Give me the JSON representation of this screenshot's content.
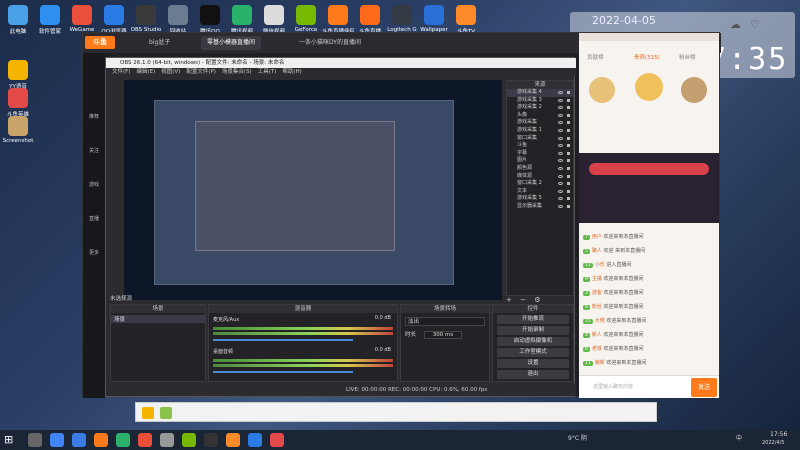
{
  "desktop_icons_top": [
    {
      "label": "此电脑",
      "color": "#4aa0e6"
    },
    {
      "label": "软件管家",
      "color": "#2f8ff0"
    },
    {
      "label": "WeGame",
      "color": "#e94f3a"
    },
    {
      "label": "QQ浏览器",
      "color": "#2b7be4"
    },
    {
      "label": "OBS Studio",
      "color": "#3a3a3a"
    },
    {
      "label": "回收站",
      "color": "#6b7c90"
    },
    {
      "label": "腾讯QQ",
      "color": "#111111"
    },
    {
      "label": "腾讯视频",
      "color": "#2ab26a"
    },
    {
      "label": "微信视频",
      "color": "#dcdcdc"
    },
    {
      "label": "GeForce",
      "color": "#76b900"
    },
    {
      "label": "斗鱼直播伴侣",
      "color": "#ff7a1a"
    },
    {
      "label": "斗鱼直播",
      "color": "#ff6a1a"
    },
    {
      "label": "Logitech G",
      "color": "#333a44"
    },
    {
      "label": "Wallpaper",
      "color": "#2a6fd6"
    },
    {
      "label": "斗鱼TV",
      "color": "#ff8a2a"
    }
  ],
  "desktop_icons_left": [
    {
      "label": "YY语音",
      "color": "#f4b400"
    },
    {
      "label": "斗鱼英雄",
      "color": "#e24a4a"
    },
    {
      "label": "Screenshot",
      "color": "#c9a46a"
    }
  ],
  "clock_widget": {
    "date": "2022-04-05",
    "time": "17:35",
    "weather_icons": [
      "☁",
      "♡"
    ]
  },
  "douyu": {
    "logo": "斗鱼",
    "tabs": [
      "big盆子",
      "零基小模器直播间",
      "一条小猫咪DY的直播间"
    ],
    "sidebar": [
      "推荐",
      "关注",
      "游戏",
      "直播",
      "更多"
    ],
    "chat_tabs": [
      "贡献榜",
      "贵宾(315)",
      "粉丝榜"
    ],
    "chat_messages": [
      {
        "level": "7",
        "name": "用户",
        "text": "欢迎来到本直播间"
      },
      {
        "level": "5",
        "name": "路人",
        "text": "欢迎 来到本直播间"
      },
      {
        "level": "12",
        "name": "小乐",
        "text": "进入直播间"
      },
      {
        "level": "9",
        "name": "主播",
        "text": "欢迎来到本直播间"
      },
      {
        "level": "3",
        "name": "游客",
        "text": "欢迎来到本直播间"
      },
      {
        "level": "8",
        "name": "粉丝",
        "text": "欢迎来到本直播间"
      },
      {
        "level": "15",
        "name": "大佬",
        "text": "欢迎来到本直播间"
      },
      {
        "level": "4",
        "name": "新人",
        "text": "欢迎来到本直播间"
      },
      {
        "level": "6",
        "name": "老铁",
        "text": "欢迎来到本直播间"
      },
      {
        "level": "11",
        "name": "萌新",
        "text": "欢迎来到本直播间"
      }
    ],
    "send_button": "发送",
    "input_placeholder": "这里输入聊天内容"
  },
  "obs": {
    "title": "OBS 26.1.0 (64-bit, windows) - 配置文件: 未命名 - 场景: 未命名",
    "menus": [
      "文件(F)",
      "编辑(E)",
      "视图(V)",
      "配置文件(P)",
      "场景集合(S)",
      "工具(T)",
      "帮助(H)"
    ],
    "sources_header": "来源",
    "sources": [
      "游戏采集 4",
      "游戏采集 3",
      "游戏采集 2",
      "头像",
      "游戏采集",
      "游戏采集 1",
      "窗口采集",
      "斗鱼",
      "字幕",
      "图片",
      "颜色源",
      "媒体源",
      "窗口采集 2",
      "文本",
      "游戏采集 5",
      "显示器采集"
    ],
    "scenes_header": "场景",
    "scene_item": "场景",
    "mixer_header": "混音器",
    "mixer": [
      {
        "name": "麦克风/Aux",
        "db": "0.0 dB"
      },
      {
        "name": "桌面音频",
        "db": "0.0 dB"
      }
    ],
    "transitions_header": "场景转场",
    "transition_type": "淡出",
    "duration_label": "时长",
    "duration_value": "300 ms",
    "controls_header": "控件",
    "controls": [
      "开始推流",
      "开始录制",
      "启动虚拟摄像机",
      "工作室模式",
      "设置",
      "退出"
    ],
    "status": "LIVE: 00:00:00   REC: 00:00:00   CPU: 0.6%, 60.00 fps",
    "scene_label": "未选择源"
  },
  "taskbar": {
    "time": "17:56",
    "date": "2022/4/5",
    "weather": "9°C 阴",
    "lang": "中"
  }
}
